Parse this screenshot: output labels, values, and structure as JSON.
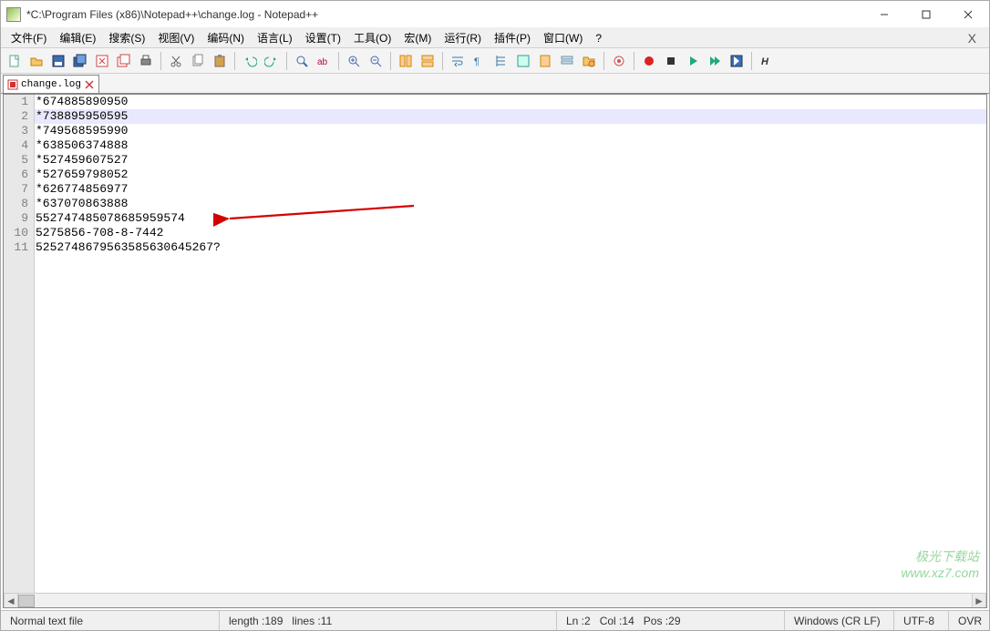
{
  "window": {
    "title": "*C:\\Program Files (x86)\\Notepad++\\change.log - Notepad++"
  },
  "menu": {
    "items": [
      "文件(F)",
      "编辑(E)",
      "搜索(S)",
      "视图(V)",
      "编码(N)",
      "语言(L)",
      "设置(T)",
      "工具(O)",
      "宏(M)",
      "运行(R)",
      "插件(P)",
      "窗口(W)",
      "?"
    ]
  },
  "toolbar": {
    "icons": [
      "new-file",
      "open-file",
      "save-file",
      "save-all",
      "close-file",
      "close-all",
      "print",
      "sep",
      "cut",
      "copy",
      "paste",
      "sep",
      "undo",
      "redo",
      "sep",
      "find",
      "replace",
      "sep",
      "zoom-in",
      "zoom-out",
      "sep",
      "sync-v",
      "sync-h",
      "sep",
      "wrap",
      "all-chars",
      "indent-guide",
      "lang-style",
      "doc-map",
      "func-list",
      "folder-tree",
      "sep",
      "monitor",
      "sep",
      "record",
      "stop",
      "play",
      "play-multi",
      "save-macro",
      "sep",
      "hex"
    ]
  },
  "tabs": [
    {
      "label": "change.log",
      "modified": true
    }
  ],
  "editor": {
    "current_line_idx": 1,
    "lines": [
      "*674885890950",
      "*738895950595",
      "*749568595990",
      "*638506374888",
      "*527459607527",
      "*527659798052",
      "*626774856977",
      "*637070863888",
      "552747485078685959574",
      "5275856-708-8-7442",
      "5252748679563585630645267?"
    ]
  },
  "status": {
    "filetype": "Normal text file",
    "length_label": "length : ",
    "length": "189",
    "lines_label": "lines : ",
    "lines": "11",
    "ln_label": "Ln : ",
    "ln": "2",
    "col_label": "Col : ",
    "col": "14",
    "pos_label": "Pos : ",
    "pos": "29",
    "eol": "Windows (CR LF)",
    "encoding": "UTF-8",
    "mode": "OVR"
  },
  "watermark": {
    "line1": "极光下载站",
    "line2": "www.xz7.com"
  }
}
